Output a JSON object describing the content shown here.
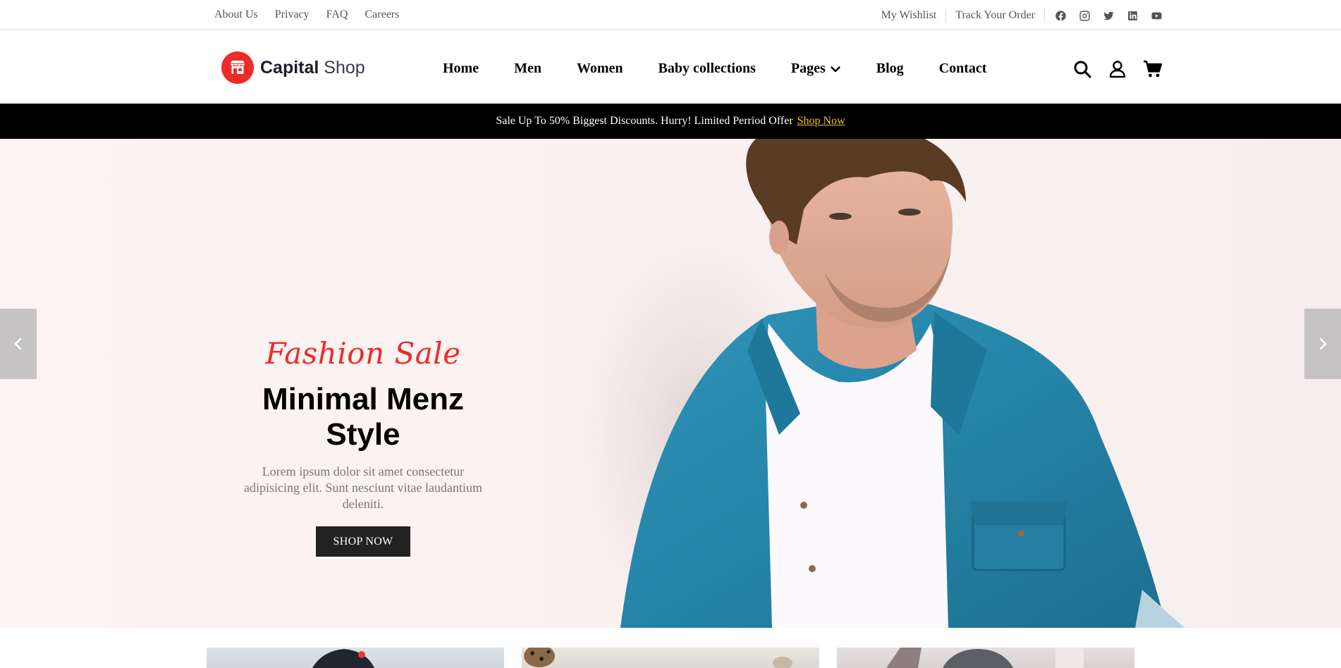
{
  "topbar": {
    "left_links": [
      "About Us",
      "Privacy",
      "FAQ",
      "Careers"
    ],
    "right_links": [
      "My Wishlist",
      "Track Your Order"
    ],
    "socials": [
      "facebook-icon",
      "instagram-icon",
      "twitter-icon",
      "linkedin-icon",
      "youtube-icon"
    ]
  },
  "header": {
    "logo": {
      "bold": "Capital",
      "light": " Shop",
      "icon": "storefront-icon"
    },
    "nav": [
      {
        "label": "Home"
      },
      {
        "label": "Men"
      },
      {
        "label": "Women"
      },
      {
        "label": "Baby collections"
      },
      {
        "label": "Pages",
        "has_dropdown": true
      },
      {
        "label": "Blog"
      },
      {
        "label": "Contact"
      }
    ],
    "icons": [
      "search-icon",
      "user-icon",
      "cart-icon"
    ]
  },
  "announcement": {
    "text": "Sale Up To 50% Biggest Discounts. Hurry! Limited Perriod Offer",
    "cta": "Shop Now"
  },
  "hero": {
    "tag": "Fashion Sale",
    "title_line1": "Minimal Menz",
    "title_line2": "Style",
    "description": "Lorem ipsum dolor sit amet consectetur adipisicing elit. Sunt nesciunt vitae laudantium deleniti.",
    "button": "SHOP NOW",
    "prev_icon": "chevron-left-icon",
    "next_icon": "chevron-right-icon"
  },
  "colors": {
    "accent": "#ee2a2a",
    "announce_bg": "#000000",
    "announce_cta": "#f2c230",
    "button_bg": "#222222",
    "hero_bg": "#fbf1f1",
    "denim": "#2a86aa"
  }
}
